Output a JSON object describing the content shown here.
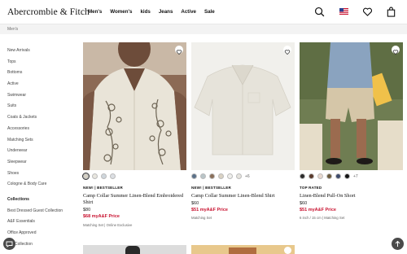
{
  "header": {
    "logo": "Abercrombie & Fitch",
    "nav": [
      "Men's",
      "Women's",
      "kids",
      "Jeans",
      "Active",
      "Sale"
    ]
  },
  "breadcrumb": "Men's",
  "sidebar": {
    "items": [
      "New Arrivals",
      "Tops",
      "Bottoms",
      "Active",
      "Swimwear",
      "Suits",
      "Coats & Jackets",
      "Accessories",
      "Matching Sets",
      "Underwear",
      "Sleepwear",
      "Shoes",
      "Cologne & Body Care"
    ],
    "collections_heading": "Collections",
    "collections": [
      "Best Dressed Guest Collection",
      "A&F Essentials",
      "Office Approved",
      "Collection"
    ]
  },
  "products": [
    {
      "badge": "NEW! | BESTSELLER",
      "name": "Camp Collar Summer Linen-Blend Embroidered Shirt",
      "price": "$80",
      "sale_price": "$68 myA&F Price",
      "note": "Matching Set | Online Exclusive",
      "more_colors": "",
      "swatch_colors": [
        "#d6d1c4",
        "#e8e6df",
        "#cfd6dc",
        "#dcdfe3"
      ]
    },
    {
      "badge": "NEW! | BESTSELLER",
      "name": "Camp Collar Summer Linen-Blend Shirt",
      "price": "$60",
      "sale_price": "$51 myA&F Price",
      "note": "Matching Set",
      "more_colors": "+6",
      "swatch_colors": [
        "#5b7189",
        "#b9c5c8",
        "#8a6f5a",
        "#d9d2c3",
        "#efefec",
        "#e6e4de"
      ]
    },
    {
      "badge": "TOP RATED",
      "name": "Linen-Blend Pull-On Short",
      "price": "$60",
      "sale_price": "$51 myA&F Price",
      "note": "6 inch / 15 cm | Matching Set",
      "more_colors": "+7",
      "swatch_colors": [
        "#2b2b2b",
        "#5a3a2c",
        "#e8d8cf",
        "#6b5a3c",
        "#3d4a6b",
        "#141414"
      ]
    }
  ],
  "colors": {
    "sale_red": "#c8102e",
    "breadcrumb_bg": "#f3f3f3"
  }
}
